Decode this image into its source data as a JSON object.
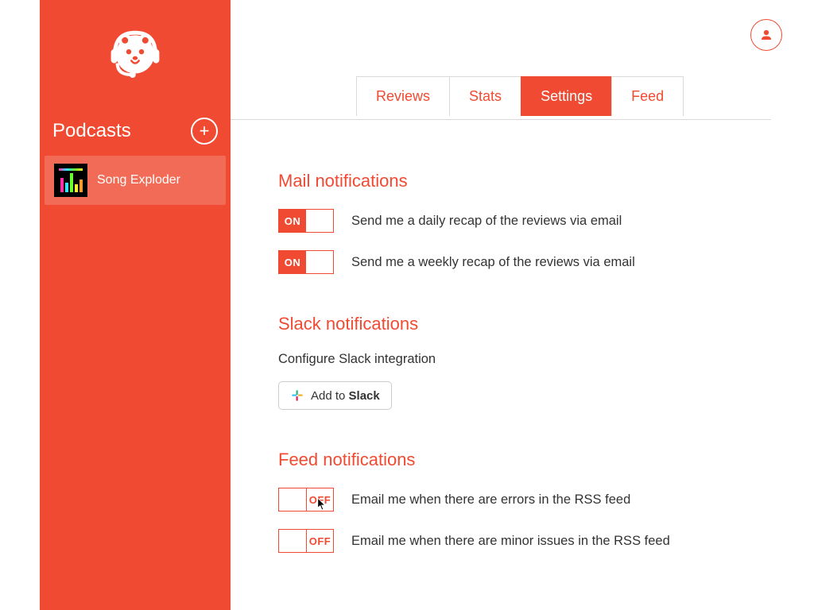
{
  "colors": {
    "accent": "#f04b32"
  },
  "sidebar": {
    "title": "Podcasts",
    "items": [
      {
        "name": "Song Exploder"
      }
    ]
  },
  "tabs": [
    {
      "label": "Reviews",
      "active": false
    },
    {
      "label": "Stats",
      "active": false
    },
    {
      "label": "Settings",
      "active": true
    },
    {
      "label": "Feed",
      "active": false
    }
  ],
  "toggle_labels": {
    "on": "ON",
    "off": "OFF"
  },
  "sections": {
    "mail": {
      "title": "Mail notifications",
      "options": [
        {
          "state": "on",
          "label": "Send me a daily recap of the reviews via email"
        },
        {
          "state": "on",
          "label": "Send me a weekly recap of the reviews via email"
        }
      ]
    },
    "slack": {
      "title": "Slack notifications",
      "subtitle": "Configure Slack integration",
      "button_prefix": "Add to ",
      "button_strong": "Slack"
    },
    "feed": {
      "title": "Feed notifications",
      "options": [
        {
          "state": "off",
          "label": "Email me when there are errors in the RSS feed"
        },
        {
          "state": "off",
          "label": "Email me when there are minor issues in the RSS feed"
        }
      ]
    }
  }
}
